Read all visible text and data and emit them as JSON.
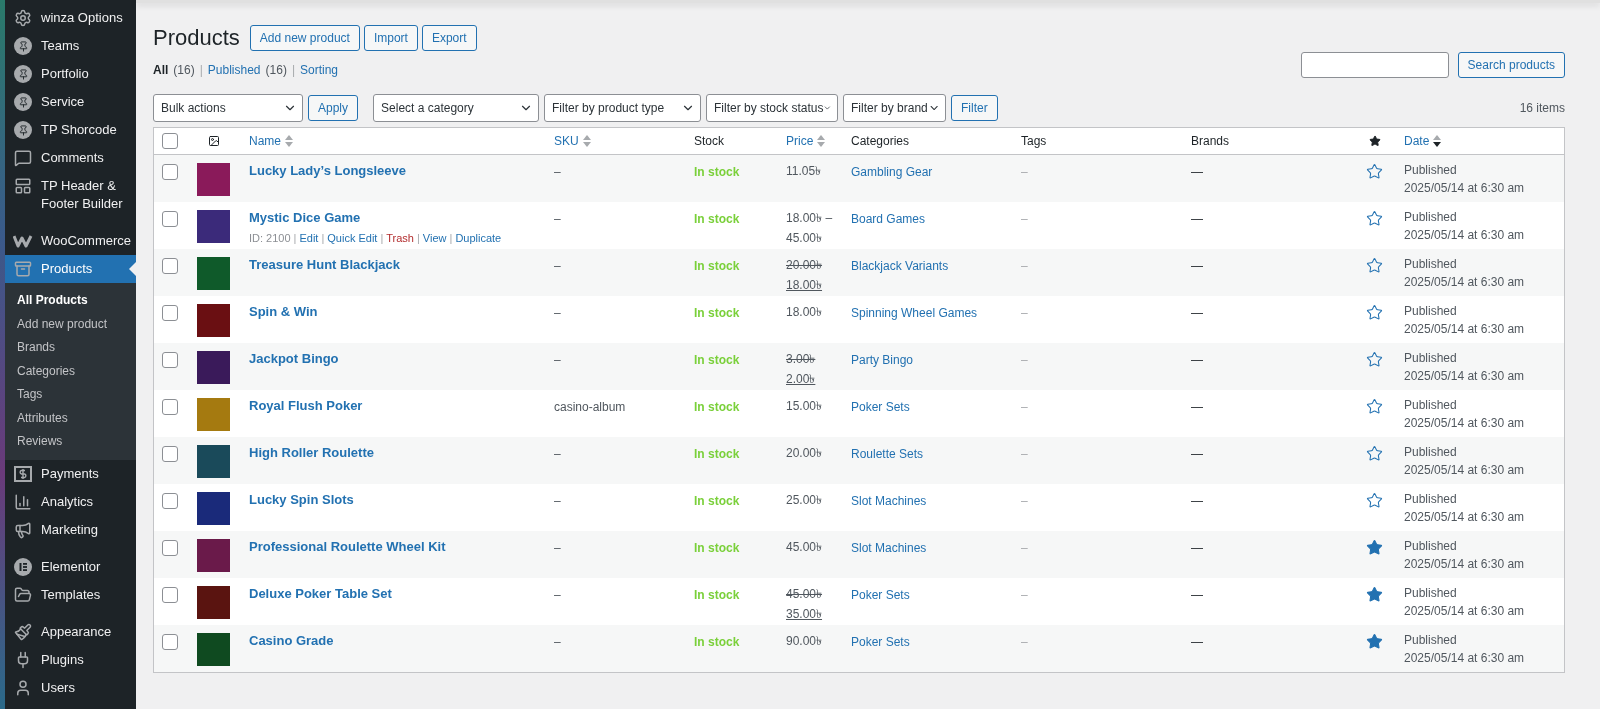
{
  "sidebar": {
    "groups": [
      [
        {
          "label": "winza Options",
          "selected": false
        },
        {
          "label": "Teams",
          "selected": false
        },
        {
          "label": "Portfolio",
          "selected": false
        },
        {
          "label": "Service",
          "selected": false
        },
        {
          "label": "TP Shorcode",
          "selected": false
        },
        {
          "label": "Comments",
          "selected": false
        },
        {
          "label": "TP Header & Footer Builder",
          "selected": false
        }
      ],
      [
        {
          "label": "WooCommerce",
          "selected": false
        },
        {
          "label": "Products",
          "selected": true,
          "children": [
            {
              "label": "All Products",
              "selected": true
            },
            {
              "label": "Add new product",
              "selected": false
            },
            {
              "label": "Brands",
              "selected": false
            },
            {
              "label": "Categories",
              "selected": false
            },
            {
              "label": "Tags",
              "selected": false
            },
            {
              "label": "Attributes",
              "selected": false
            },
            {
              "label": "Reviews",
              "selected": false
            }
          ]
        },
        {
          "label": "Payments",
          "selected": false
        },
        {
          "label": "Analytics",
          "selected": false
        },
        {
          "label": "Marketing",
          "selected": false
        }
      ],
      [
        {
          "label": "Elementor",
          "selected": false
        },
        {
          "label": "Templates",
          "selected": false
        }
      ],
      [
        {
          "label": "Appearance",
          "selected": false
        },
        {
          "label": "Plugins",
          "selected": false
        },
        {
          "label": "Users",
          "selected": false
        }
      ]
    ]
  },
  "page": {
    "title": "Products",
    "actions": [
      "Add new product",
      "Import",
      "Export"
    ]
  },
  "views": {
    "separator": "|",
    "items": [
      {
        "label": "All",
        "count": "(16)",
        "selected": true
      },
      {
        "label": "Published",
        "count": "(16)",
        "selected": false
      },
      {
        "label": "Sorting",
        "selected": false
      }
    ]
  },
  "search": {
    "button": "Search products"
  },
  "filters": {
    "bulk": "Bulk actions",
    "apply": "Apply",
    "selects": [
      "Select a category",
      "Filter by product type",
      "Filter by stock status",
      "Filter by brand"
    ],
    "filter": "Filter",
    "count": "16 items"
  },
  "table": {
    "select_all": {
      "checked": false
    },
    "columns": [
      {
        "kind": "image"
      },
      {
        "kind": "text",
        "label": "Name",
        "sortable": true,
        "sorted_desc": false
      },
      {
        "kind": "text",
        "label": "SKU",
        "sortable": true,
        "sorted_desc": false
      },
      {
        "kind": "text",
        "label": "Stock",
        "sortable": false
      },
      {
        "kind": "text",
        "label": "Price",
        "sortable": true,
        "sorted_desc": false
      },
      {
        "kind": "text",
        "label": "Categories",
        "sortable": false
      },
      {
        "kind": "text",
        "label": "Tags",
        "sortable": false
      },
      {
        "kind": "text",
        "label": "Brands",
        "sortable": false
      },
      {
        "kind": "featured"
      },
      {
        "kind": "text",
        "label": "Date",
        "sortable": true,
        "sorted_desc": true
      }
    ],
    "action_separator": "|",
    "rows": [
      {
        "selected": false,
        "name": "Lucky Lady’s Longsleeve",
        "sku": "–",
        "stock": "In stock",
        "price": {
          "kind": "single",
          "value": "11.05৳"
        },
        "category": "Gambling Gear",
        "tags": "–",
        "brands": "—",
        "featured": false,
        "status": "Published",
        "date": "2025/05/14 at 6:30 am"
      },
      {
        "selected": false,
        "name": "Mystic Dice Game",
        "actions": [
          {
            "kind": "id",
            "label": "ID: 2100"
          },
          {
            "kind": "link",
            "label": "Edit"
          },
          {
            "kind": "link",
            "label": "Quick Edit"
          },
          {
            "kind": "danger",
            "label": "Trash"
          },
          {
            "kind": "link",
            "label": "View"
          },
          {
            "kind": "link",
            "label": "Duplicate"
          }
        ],
        "sku": "–",
        "stock": "In stock",
        "price": {
          "kind": "range",
          "from": "18.00৳",
          "separator": "–",
          "to": "45.00৳"
        },
        "category": "Board Games",
        "tags": "–",
        "brands": "—",
        "featured": false,
        "status": "Published",
        "date": "2025/05/14 at 6:30 am"
      },
      {
        "selected": false,
        "name": "Treasure Hunt Blackjack",
        "sku": "–",
        "stock": "In stock",
        "price": {
          "kind": "sale",
          "regular": "20.00৳",
          "sale": "18.00৳"
        },
        "category": "Blackjack Variants",
        "tags": "–",
        "brands": "—",
        "featured": false,
        "status": "Published",
        "date": "2025/05/14 at 6:30 am"
      },
      {
        "selected": false,
        "name": "Spin & Win",
        "sku": "–",
        "stock": "In stock",
        "price": {
          "kind": "single",
          "value": "18.00৳"
        },
        "category": "Spinning Wheel Games",
        "tags": "–",
        "brands": "—",
        "featured": false,
        "status": "Published",
        "date": "2025/05/14 at 6:30 am"
      },
      {
        "selected": false,
        "name": "Jackpot Bingo",
        "sku": "–",
        "stock": "In stock",
        "price": {
          "kind": "sale",
          "regular": "3.00৳",
          "sale": "2.00৳"
        },
        "category": "Party Bingo",
        "tags": "–",
        "brands": "—",
        "featured": false,
        "status": "Published",
        "date": "2025/05/14 at 6:30 am"
      },
      {
        "selected": false,
        "name": "Royal Flush Poker",
        "sku": "casino-album",
        "stock": "In stock",
        "price": {
          "kind": "single",
          "value": "15.00৳"
        },
        "category": "Poker Sets",
        "tags": "–",
        "brands": "—",
        "featured": false,
        "status": "Published",
        "date": "2025/05/14 at 6:30 am"
      },
      {
        "selected": false,
        "name": "High Roller Roulette",
        "sku": "–",
        "stock": "In stock",
        "price": {
          "kind": "single",
          "value": "20.00৳"
        },
        "category": "Roulette Sets",
        "tags": "–",
        "brands": "—",
        "featured": false,
        "status": "Published",
        "date": "2025/05/14 at 6:30 am"
      },
      {
        "selected": false,
        "name": "Lucky Spin Slots",
        "sku": "–",
        "stock": "In stock",
        "price": {
          "kind": "single",
          "value": "25.00৳"
        },
        "category": "Slot Machines",
        "tags": "–",
        "brands": "—",
        "featured": false,
        "status": "Published",
        "date": "2025/05/14 at 6:30 am"
      },
      {
        "selected": false,
        "name": "Professional Roulette Wheel Kit",
        "sku": "–",
        "stock": "In stock",
        "price": {
          "kind": "single",
          "value": "45.00৳"
        },
        "category": "Slot Machines",
        "tags": "–",
        "brands": "—",
        "featured": true,
        "status": "Published",
        "date": "2025/05/14 at 6:30 am"
      },
      {
        "selected": false,
        "name": "Deluxe Poker Table Set",
        "sku": "–",
        "stock": "In stock",
        "price": {
          "kind": "sale",
          "regular": "45.00৳",
          "sale": "35.00৳"
        },
        "category": "Poker Sets",
        "tags": "–",
        "brands": "—",
        "featured": true,
        "status": "Published",
        "date": "2025/05/14 at 6:30 am"
      },
      {
        "selected": false,
        "name": "Casino Grade",
        "sku": "–",
        "stock": "In stock",
        "price": {
          "kind": "single",
          "value": "90.00৳"
        },
        "category": "Poker Sets",
        "tags": "–",
        "brands": "—",
        "featured": true,
        "status": "Published",
        "date": "2025/05/14 at 6:30 am"
      }
    ]
  }
}
